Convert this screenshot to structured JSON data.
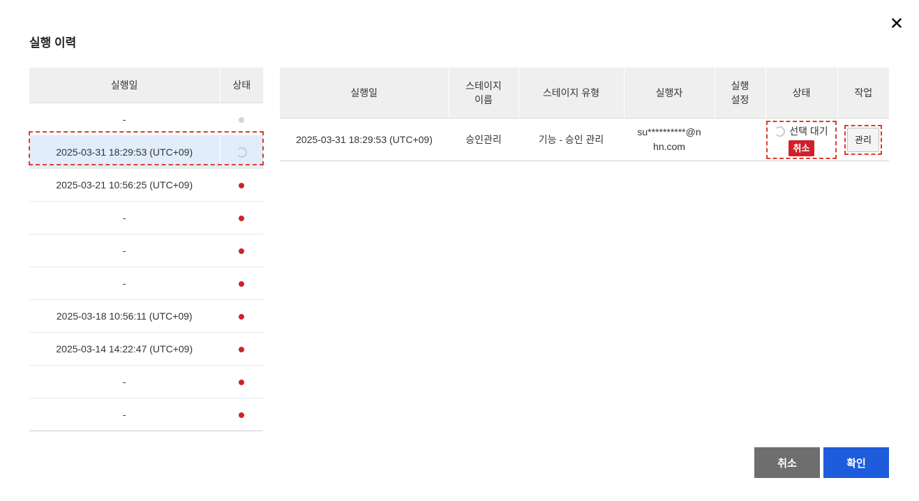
{
  "modal": {
    "title": "실행 이력",
    "close_icon": "close-icon"
  },
  "history": {
    "headers": {
      "date": "실행일",
      "status": "상태"
    },
    "rows": [
      {
        "date": "-",
        "status": "gray"
      },
      {
        "date": "2025-03-31 18:29:53 (UTC+09)",
        "status": "loading",
        "selected": true
      },
      {
        "date": "2025-03-21 10:56:25 (UTC+09)",
        "status": "red"
      },
      {
        "date": "-",
        "status": "red"
      },
      {
        "date": "-",
        "status": "red"
      },
      {
        "date": "-",
        "status": "red"
      },
      {
        "date": "2025-03-18 10:56:11 (UTC+09)",
        "status": "red"
      },
      {
        "date": "2025-03-14 14:22:47 (UTC+09)",
        "status": "red"
      },
      {
        "date": "-",
        "status": "red"
      },
      {
        "date": "-",
        "status": "red"
      }
    ]
  },
  "stages": {
    "headers": {
      "date": "실행일",
      "stage_name_1": "스테이지",
      "stage_name_2": "이름",
      "stage_type": "스테이지 유형",
      "executor": "실행자",
      "settings_1": "실행",
      "settings_2": "설정",
      "status": "상태",
      "action": "작업"
    },
    "row": {
      "date": "2025-03-31 18:29:53 (UTC+09)",
      "stage_name": "승인관리",
      "stage_type": "기능 - 승인 관리",
      "executor_1": "su**********@n",
      "executor_2": "hn.com",
      "settings": "",
      "status_text": "선택 대기",
      "status_badge": "취소",
      "action_label": "관리"
    }
  },
  "footer": {
    "cancel_label": "취소",
    "confirm_label": "확인"
  },
  "colors": {
    "status_red": "#d0212b",
    "status_gray": "#d4d4d4",
    "confirm_blue": "#1d5cdb",
    "cancel_gray": "#6e6e6e",
    "selected_row": "#e1edfb",
    "highlight_outline": "#e03a2a"
  }
}
